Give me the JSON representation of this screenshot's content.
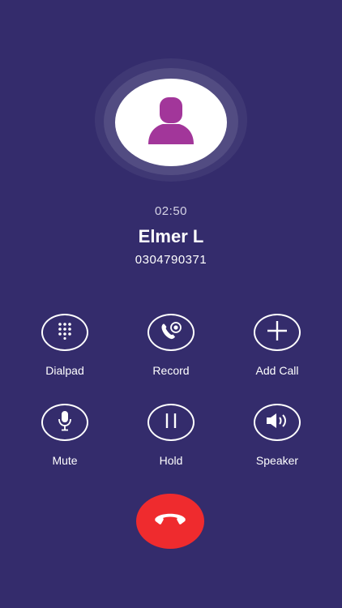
{
  "call": {
    "timer": "02:50",
    "caller_name": "Elmer L",
    "caller_number": "0304790371"
  },
  "controls": {
    "dialpad": {
      "label": "Dialpad",
      "icon": "dialpad-icon"
    },
    "record": {
      "label": "Record",
      "icon": "record-icon"
    },
    "add_call": {
      "label": "Add Call",
      "icon": "plus-icon"
    },
    "mute": {
      "label": "Mute",
      "icon": "microphone-icon"
    },
    "hold": {
      "label": "Hold",
      "icon": "pause-icon"
    },
    "speaker": {
      "label": "Speaker",
      "icon": "speaker-icon"
    }
  },
  "end_call": {
    "icon": "hang-up-icon"
  },
  "colors": {
    "background": "#342c6c",
    "avatar_accent": "#a2369a",
    "end_call": "#ef2b2e",
    "text": "#ffffff"
  }
}
